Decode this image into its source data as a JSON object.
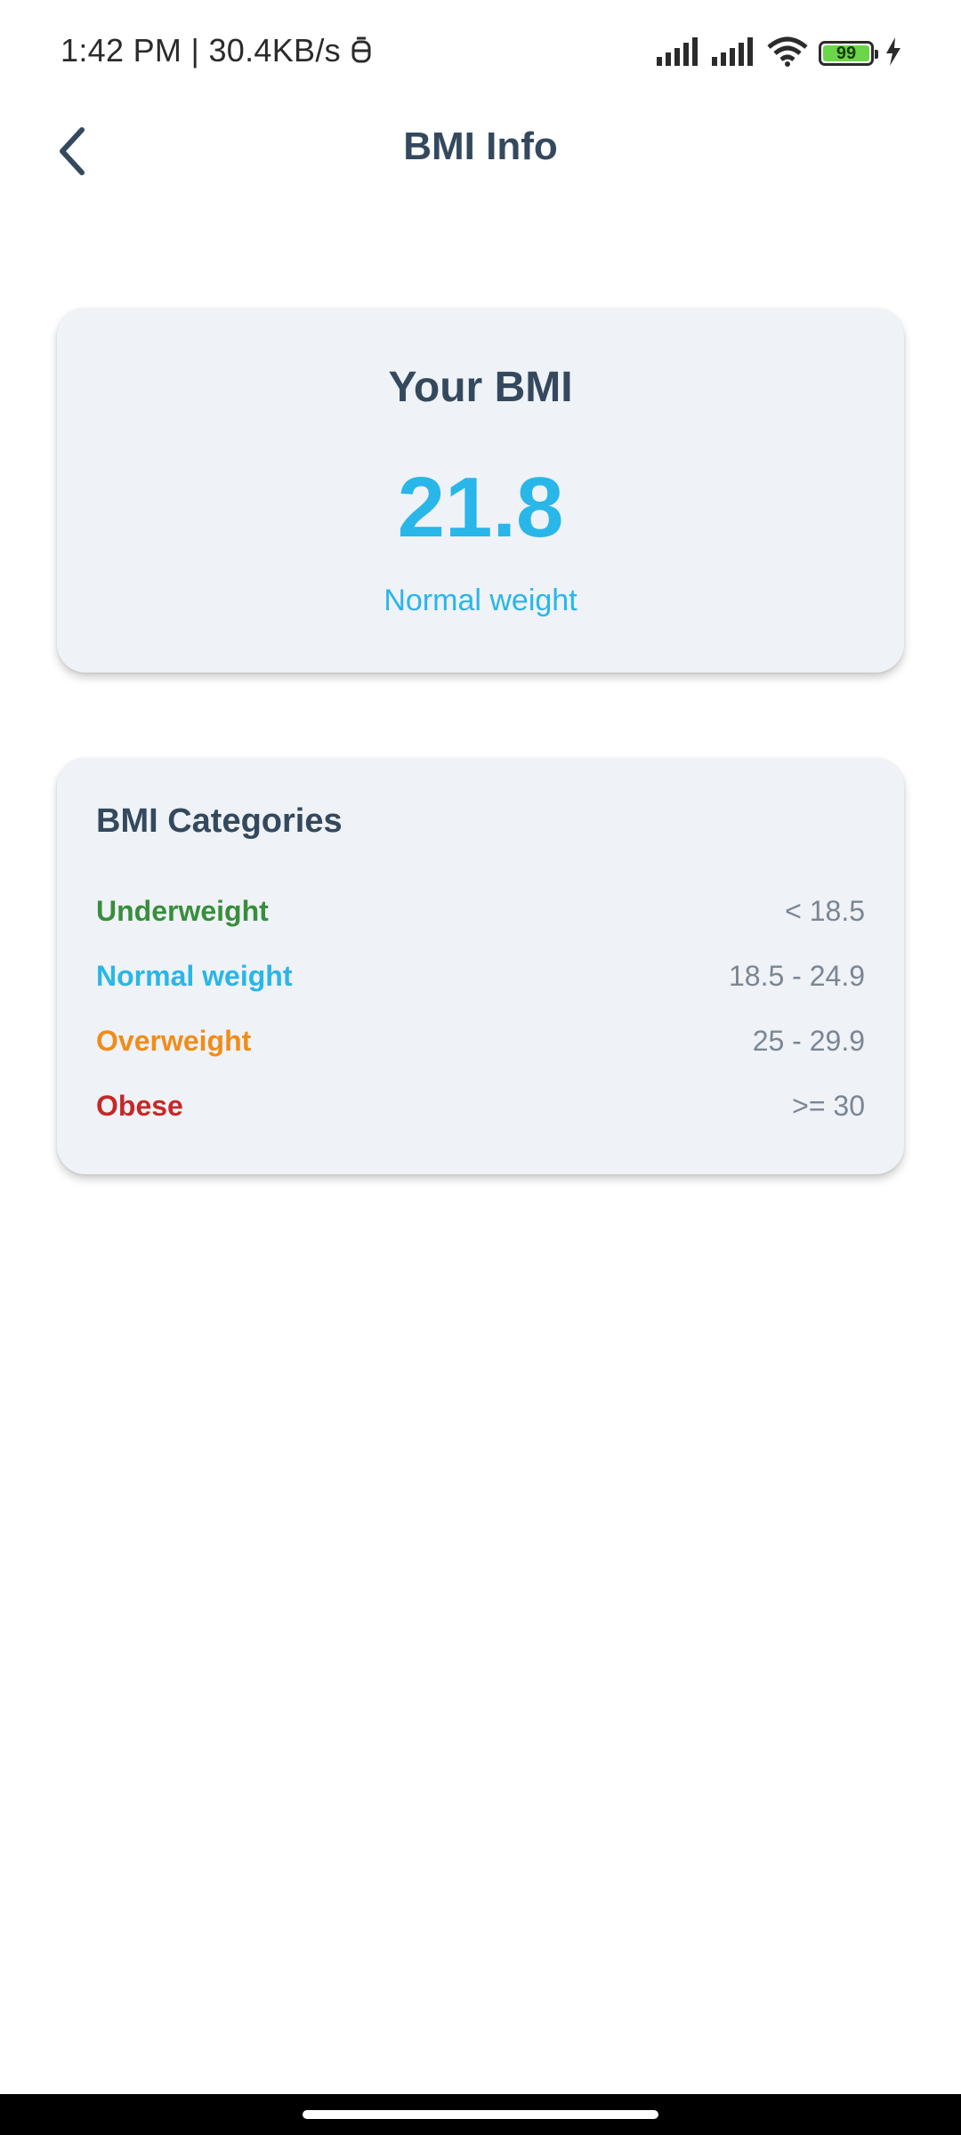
{
  "status_bar": {
    "time": "1:42 PM",
    "separator": "|",
    "network_speed": "30.4KB/s",
    "battery": "99",
    "icons": [
      "notification-icon",
      "signal-icon",
      "signal-icon",
      "wifi-icon",
      "battery-icon",
      "charging-icon"
    ]
  },
  "header": {
    "title": "BMI Info",
    "back_icon": "back-arrow-icon"
  },
  "bmi_card": {
    "label": "Your BMI",
    "value": "21.8",
    "status": "Normal weight",
    "value_color": "#29b6e8"
  },
  "categories": {
    "title": "BMI Categories",
    "items": [
      {
        "name": "Underweight",
        "range": "< 18.5",
        "color": "#388e3c"
      },
      {
        "name": "Normal weight",
        "range": "18.5 - 24.9",
        "color": "#29b6e8"
      },
      {
        "name": "Overweight",
        "range": "25 - 29.9",
        "color": "#f08c1a"
      },
      {
        "name": "Obese",
        "range": ">= 30",
        "color": "#c62828"
      }
    ]
  },
  "colors": {
    "title_text": "#34495e",
    "card_bg": "#eff2f6",
    "range_text": "#7a8694"
  }
}
